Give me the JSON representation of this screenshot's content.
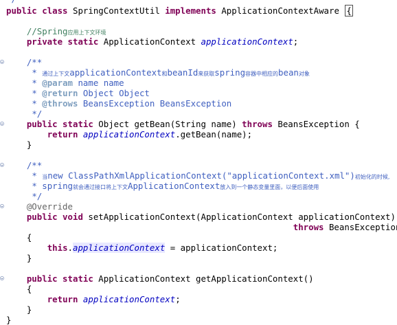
{
  "editor": {
    "top_fragment": "*/",
    "lines": [
      {
        "parts": [
          [
            "kw",
            "public class "
          ],
          [
            "",
            "SpringContextUtil "
          ],
          [
            "kw",
            "implements "
          ],
          [
            "",
            "ApplicationContextAware "
          ],
          [
            "box",
            "{"
          ]
        ]
      },
      {
        "parts": []
      },
      {
        "parts": [
          [
            "",
            "    "
          ],
          [
            "cm",
            "//Spring"
          ],
          [
            "cmcjk",
            "应用上下文环境"
          ]
        ]
      },
      {
        "parts": [
          [
            "",
            "    "
          ],
          [
            "kw",
            "private static "
          ],
          [
            "",
            "ApplicationContext "
          ],
          [
            "fld",
            "applicationContext"
          ],
          [
            "",
            ";"
          ]
        ]
      },
      {
        "parts": []
      },
      {
        "parts": [
          [
            "",
            "    "
          ],
          [
            "jd",
            "/**"
          ]
        ]
      },
      {
        "parts": [
          [
            "",
            "     "
          ],
          [
            "jd",
            "* "
          ],
          [
            "jdcjk",
            "通过上下文"
          ],
          [
            "jd",
            "applicationContext"
          ],
          [
            "jdcjk",
            "和"
          ],
          [
            "jd",
            "beanId"
          ],
          [
            "jdcjk",
            "来获取"
          ],
          [
            "jd",
            "spring"
          ],
          [
            "jdcjk",
            "容器中相应的"
          ],
          [
            "jd",
            "bean"
          ],
          [
            "jdcjk",
            "对象"
          ]
        ]
      },
      {
        "parts": [
          [
            "",
            "     "
          ],
          [
            "jd",
            "* "
          ],
          [
            "tag",
            "@param"
          ],
          [
            "jd",
            " name name"
          ]
        ]
      },
      {
        "parts": [
          [
            "",
            "     "
          ],
          [
            "jd",
            "* "
          ],
          [
            "tag",
            "@return"
          ],
          [
            "jd",
            " Object Object"
          ]
        ]
      },
      {
        "parts": [
          [
            "",
            "     "
          ],
          [
            "jd",
            "* "
          ],
          [
            "tag",
            "@throws"
          ],
          [
            "jd",
            " BeansException BeansException"
          ]
        ]
      },
      {
        "parts": [
          [
            "",
            "     "
          ],
          [
            "jd",
            "*/"
          ]
        ]
      },
      {
        "parts": [
          [
            "",
            "    "
          ],
          [
            "kw",
            "public static "
          ],
          [
            "",
            "Object getBean(String name) "
          ],
          [
            "kw",
            "throws "
          ],
          [
            "",
            "BeansException {"
          ]
        ]
      },
      {
        "parts": [
          [
            "",
            "        "
          ],
          [
            "kw",
            "return "
          ],
          [
            "fld",
            "applicationContext"
          ],
          [
            "",
            ".getBean(name);"
          ]
        ]
      },
      {
        "parts": [
          [
            "",
            "    }"
          ]
        ]
      },
      {
        "parts": []
      },
      {
        "parts": [
          [
            "",
            "    "
          ],
          [
            "jd",
            "/**"
          ]
        ]
      },
      {
        "parts": [
          [
            "",
            "     "
          ],
          [
            "jd",
            "* "
          ],
          [
            "jdcjk",
            "当"
          ],
          [
            "jd",
            "new ClassPathXmlApplicationContext(\"applicationContext.xml\")"
          ],
          [
            "jdcjk",
            "初始化的时候,"
          ]
        ]
      },
      {
        "parts": [
          [
            "",
            "     "
          ],
          [
            "jd",
            "* spring"
          ],
          [
            "jdcjk",
            "就会通过接口将上下文"
          ],
          [
            "jd",
            "ApplicationContext"
          ],
          [
            "jdcjk",
            "放入到一个静态变量里面，以便后面使用"
          ]
        ]
      },
      {
        "parts": [
          [
            "",
            "     "
          ],
          [
            "jd",
            "*/"
          ]
        ]
      },
      {
        "parts": [
          [
            "",
            "    "
          ],
          [
            "ann",
            "@Override"
          ]
        ]
      },
      {
        "parts": [
          [
            "",
            "    "
          ],
          [
            "kw",
            "public void "
          ],
          [
            "",
            "setApplicationContext(ApplicationContext applicationContext)"
          ]
        ]
      },
      {
        "parts": [
          [
            "",
            "                                                        "
          ],
          [
            "kw",
            "throws "
          ],
          [
            "",
            "BeansException"
          ]
        ]
      },
      {
        "parts": [
          [
            "",
            "    {"
          ]
        ]
      },
      {
        "parts": [
          [
            "",
            "        "
          ],
          [
            "kw",
            "this"
          ],
          [
            "",
            "."
          ],
          [
            "fldocc",
            "applicationContext"
          ],
          [
            "",
            " = applicationContext;"
          ]
        ]
      },
      {
        "parts": [
          [
            "",
            "    }"
          ]
        ]
      },
      {
        "parts": []
      },
      {
        "parts": [
          [
            "",
            "    "
          ],
          [
            "kw",
            "public static "
          ],
          [
            "",
            "ApplicationContext getApplicationContext()"
          ]
        ]
      },
      {
        "parts": [
          [
            "",
            "    {"
          ]
        ]
      },
      {
        "parts": [
          [
            "",
            "        "
          ],
          [
            "kw",
            "return "
          ],
          [
            "fld",
            "applicationContext"
          ],
          [
            "",
            ";"
          ]
        ]
      },
      {
        "parts": [
          [
            "",
            "    }"
          ]
        ]
      },
      {
        "parts": [
          [
            "",
            "}"
          ]
        ]
      }
    ],
    "fold_marker_lines": [
      5,
      11,
      15,
      19,
      26
    ]
  }
}
